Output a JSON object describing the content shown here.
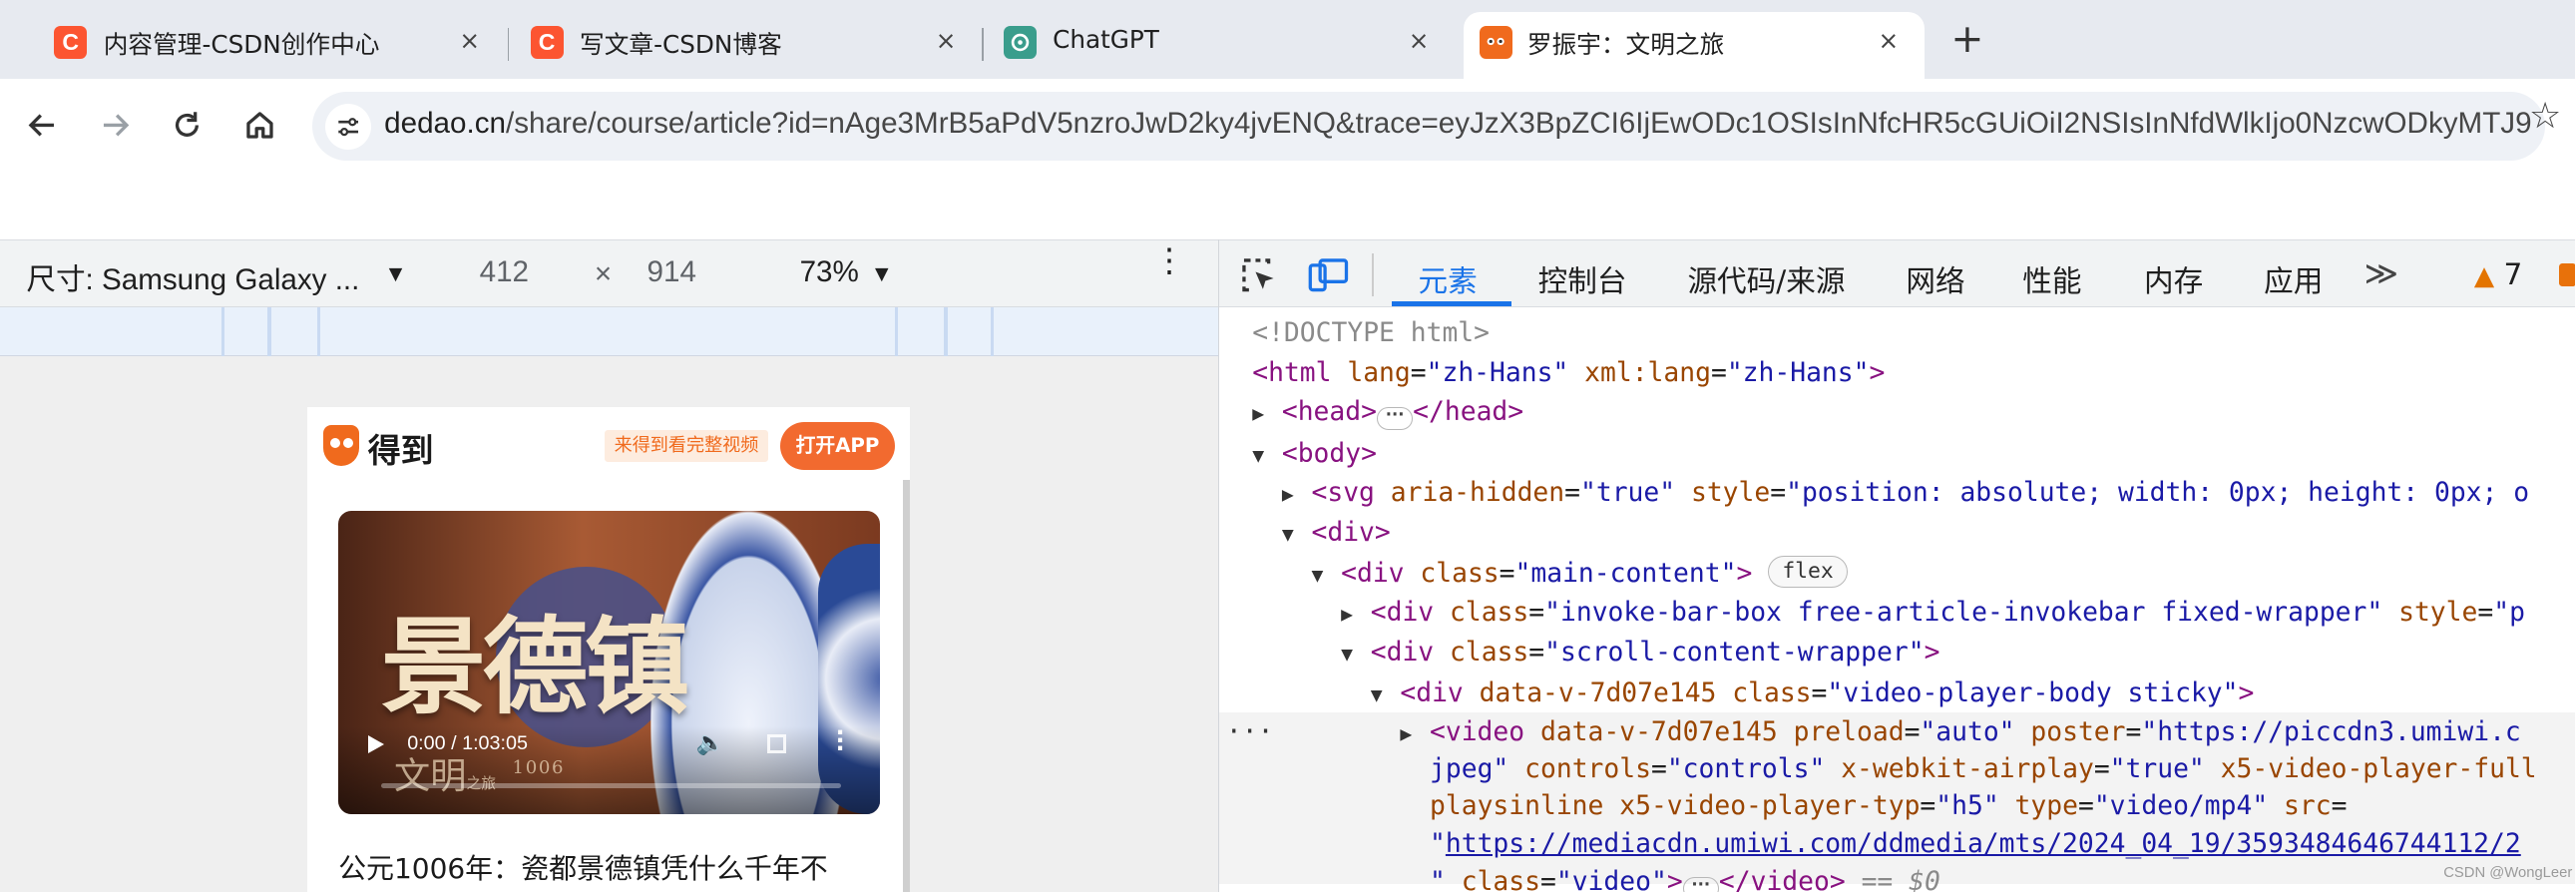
{
  "browser": {
    "tabs": [
      {
        "title": "内容管理-CSDN创作中心",
        "favicon": "csdn-icon",
        "favicon_glyph": "C",
        "active": false
      },
      {
        "title": "写文章-CSDN博客",
        "favicon": "csdn-icon",
        "favicon_glyph": "C",
        "active": false
      },
      {
        "title": "ChatGPT",
        "favicon": "chatgpt-icon",
        "active": false
      },
      {
        "title": "罗振宇：文明之旅",
        "favicon": "dedao-icon",
        "active": true
      }
    ],
    "close_glyph": "×",
    "new_tab_glyph": "+",
    "url_domain": "dedao.cn",
    "url_path": "/share/course/article?id=nAge3MrB5aPdV5nzroJwD2ky4jvENQ&trace=eyJzX3BpZCI6IjEwODc1OSIsInNfcHR5cGUiOiI2NSIsInNfdWlkIjo0NzcwODkyMTJ9",
    "star_glyph": "☆"
  },
  "device_toolbar": {
    "device_label": "尺寸: Samsung Galaxy ...",
    "width": "412",
    "times": "×",
    "height": "914",
    "zoom": "73%",
    "caret": "▼",
    "menu_glyph": "⋮"
  },
  "page": {
    "brand": "得到",
    "promo": "来得到看完整视频",
    "open_app": "打开APP",
    "video_title_art": "景德镇",
    "watermark_text": "文明",
    "watermark_sub": "之旅",
    "watermark_year": "1006",
    "time": "0:00 / 1:03:05",
    "article_title": "公元1006年：瓷都景德镇凭什么千年不"
  },
  "devtools": {
    "tabs": [
      "元素",
      "控制台",
      "源代码/来源",
      "网络",
      "性能",
      "内存",
      "应用"
    ],
    "active_tab": 0,
    "more_glyph": "≫",
    "warning_glyph": "▲",
    "warning_count": "7",
    "dom": {
      "doctype": "<!DOCTYPE html>",
      "html_tag": "html",
      "lang_attr": "lang",
      "lang_val": "\"zh-Hans\"",
      "xml_lang_attr": "xml:lang",
      "xml_lang_val": "\"zh-Hans\"",
      "head_open": "<head>",
      "head_close": "</head>",
      "body_open": "<body>",
      "svg_tag": "<svg",
      "aria_attr": "aria-hidden",
      "aria_val": "\"true\"",
      "style_attr": "style",
      "svg_style_val": "\"position: absolute; width: 0px; height: 0px; o",
      "div_open": "<div>",
      "div_tag": "<div",
      "class_attr": "class",
      "main_class": "\"main-content\"",
      "flex_badge": "flex",
      "invoke_class": "\"invoke-bar-box free-article-invokebar fixed-wrapper\"",
      "invoke_style_trunc": "\"p",
      "scroll_class": "\"scroll-content-wrapper\"",
      "video_player_attr": "data-v-7d07e145",
      "video_player_class": "\"video-player-body sticky\"",
      "video_tag": "<video",
      "preload_attr": "preload",
      "preload_val": "\"auto\"",
      "poster_attr": "poster",
      "poster_val": "\"https://piccdn3.umiwi.c",
      "jpeg_tail": "jpeg\"",
      "controls_attr": "controls",
      "controls_val": "\"controls\"",
      "airplay_attr": "x-webkit-airplay",
      "airplay_val": "\"true\"",
      "x5_full_attr": "x5-video-player-full",
      "playsinline_attr": "playsinline",
      "x5_type_attr": "x5-video-player-typ",
      "x5_type_val": "\"h5\"",
      "type_attr": "type",
      "type_val": "\"video/mp4\"",
      "src_attr": "src",
      "src_url": "https://mediacdn.umiwi.com/ddmedia/mts/2024_04_19/3593484646744112/2",
      "quote": "\"",
      "video_class_val": "\"video\"",
      "video_close": "</video>",
      "eq_dollar": "== $0",
      "row_dots": "···"
    }
  },
  "watermark": "CSDN @WongLeer"
}
